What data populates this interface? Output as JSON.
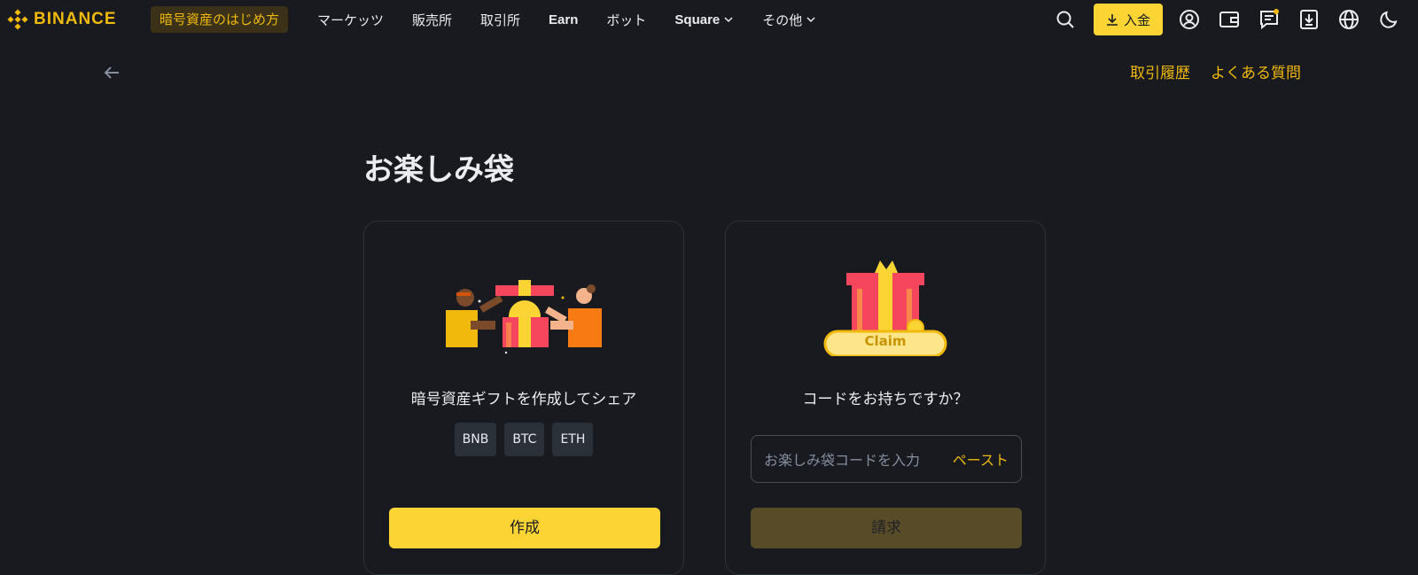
{
  "brand": {
    "name": "BINANCE",
    "color": "#f0b90b"
  },
  "header": {
    "promo_label": "暗号資産のはじめ方",
    "nav": [
      {
        "label": "マーケッツ"
      },
      {
        "label": "販売所"
      },
      {
        "label": "取引所"
      },
      {
        "label": "Earn"
      },
      {
        "label": "ボット"
      },
      {
        "label": "Square"
      },
      {
        "label": "その他"
      }
    ],
    "deposit_label": "入金",
    "icons": [
      "search-icon",
      "download-icon",
      "user-icon",
      "wallet-icon",
      "message-icon",
      "download-app-icon",
      "globe-icon",
      "moon-icon"
    ]
  },
  "subbar": {
    "history_link": "取引履歴",
    "faq_link": "よくある質問"
  },
  "page": {
    "title": "お楽しみ袋",
    "create_card": {
      "text": "暗号資産ギフトを作成してシェア",
      "chips": [
        "BNB",
        "BTC",
        "ETH"
      ],
      "button_label": "作成"
    },
    "claim_card": {
      "badge_label": "Claim",
      "text": "コードをお持ちですか？",
      "input_placeholder": "お楽しみ袋コードを入力",
      "paste_label": "ペースト",
      "button_label": "請求"
    }
  },
  "colors": {
    "accent": "#fcd535",
    "background": "#181a20",
    "card_border": "#2b3139",
    "disabled_button": "#574b28"
  }
}
